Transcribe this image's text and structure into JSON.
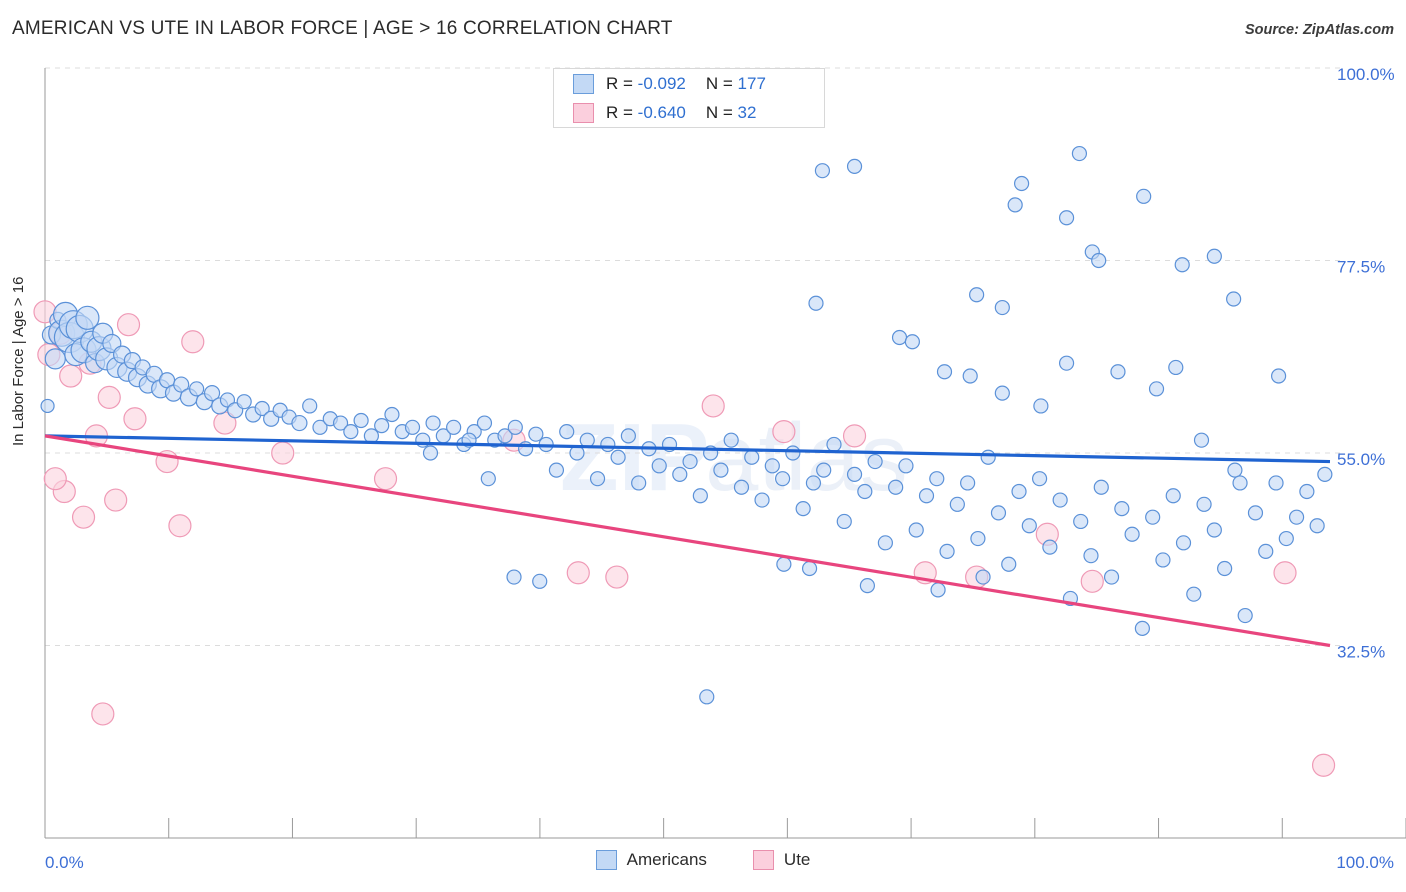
{
  "header": {
    "title": "AMERICAN VS UTE IN LABOR FORCE | AGE > 16 CORRELATION CHART",
    "source": "Source: ZipAtlas.com"
  },
  "watermark": {
    "part1": "ZIP",
    "part2": "atlas"
  },
  "axes": {
    "y_title": "In Labor Force | Age > 16",
    "y_ticks": [
      "100.0%",
      "77.5%",
      "55.0%",
      "32.5%"
    ],
    "x_left_label": "0.0%",
    "x_right_label": "100.0%"
  },
  "stats_legend": {
    "rows": [
      {
        "color": "#c3d9f5",
        "r_label": "R =",
        "r_value": "-0.092",
        "n_label": "N =",
        "n_value": "177"
      },
      {
        "color": "#fbcfdd",
        "r_label": "R =",
        "r_value": "-0.640",
        "n_label": "N =",
        "n_value": " 32"
      }
    ]
  },
  "series_legend": [
    {
      "label": "Americans",
      "color": "#c3d9f5"
    },
    {
      "label": "Ute",
      "color": "#fbcfdd"
    }
  ],
  "colors": {
    "blue_fill": "#c3d9f5",
    "blue_stroke": "#5b91d8",
    "pink_fill": "#fbd3df",
    "pink_stroke": "#ef9ab6",
    "blue_line": "#1f63d0",
    "pink_line": "#e8457e",
    "axis": "#9a9a9a",
    "grid": "#dcdcdc",
    "label_blue": "#3d6fd6"
  },
  "chart_data": {
    "type": "scatter",
    "title": "AMERICAN VS UTE IN LABOR FORCE | AGE > 16 CORRELATION CHART",
    "xlabel": "",
    "ylabel": "In Labor Force | Age > 16",
    "xlim": [
      0,
      100
    ],
    "ylim": [
      10.0,
      100.0
    ],
    "x_tick_values": [
      0,
      100
    ],
    "y_tick_values": [
      100.0,
      77.5,
      55.0,
      32.5
    ],
    "grid": "horizontal-dashed",
    "legend_position": "bottom-center",
    "series": [
      {
        "name": "Americans",
        "color": "#c3d9f5",
        "r": -0.092,
        "n": 177,
        "trendline": {
          "x0": 0,
          "y0": 57.0,
          "x1": 100,
          "y1": 54.0,
          "color": "#1f63d0"
        },
        "points": [
          [
            0.2,
            60.5,
            13
          ],
          [
            0.5,
            68.8,
            18
          ],
          [
            0.8,
            66.0,
            20
          ],
          [
            1.0,
            70.5,
            16
          ],
          [
            1.3,
            69.0,
            26
          ],
          [
            1.6,
            71.2,
            24
          ],
          [
            1.9,
            68.5,
            30
          ],
          [
            2.2,
            70.0,
            28
          ],
          [
            2.4,
            66.5,
            22
          ],
          [
            2.7,
            69.5,
            27
          ],
          [
            3.0,
            67.0,
            25
          ],
          [
            3.3,
            70.8,
            23
          ],
          [
            3.6,
            68.0,
            21
          ],
          [
            3.9,
            65.5,
            19
          ],
          [
            4.2,
            67.2,
            24
          ],
          [
            4.5,
            69.0,
            20
          ],
          [
            4.8,
            66.0,
            22
          ],
          [
            5.2,
            67.8,
            18
          ],
          [
            5.6,
            65.0,
            20
          ],
          [
            6.0,
            66.5,
            17
          ],
          [
            6.4,
            64.5,
            19
          ],
          [
            6.8,
            65.8,
            16
          ],
          [
            7.2,
            63.8,
            18
          ],
          [
            7.6,
            65.0,
            15
          ],
          [
            8.0,
            63.0,
            17
          ],
          [
            8.5,
            64.2,
            16
          ],
          [
            9.0,
            62.5,
            18
          ],
          [
            9.5,
            63.5,
            15
          ],
          [
            10.0,
            62.0,
            16
          ],
          [
            10.6,
            63.0,
            15
          ],
          [
            11.2,
            61.5,
            17
          ],
          [
            11.8,
            62.5,
            14
          ],
          [
            12.4,
            61.0,
            16
          ],
          [
            13.0,
            62.0,
            15
          ],
          [
            13.6,
            60.5,
            16
          ],
          [
            14.2,
            61.2,
            14
          ],
          [
            14.8,
            60.0,
            15
          ],
          [
            15.5,
            61.0,
            14
          ],
          [
            16.2,
            59.5,
            15
          ],
          [
            16.9,
            60.2,
            14
          ],
          [
            17.6,
            59.0,
            15
          ],
          [
            18.3,
            60.0,
            14
          ],
          [
            19.0,
            59.2,
            14
          ],
          [
            19.8,
            58.5,
            15
          ],
          [
            20.6,
            60.5,
            14
          ],
          [
            21.4,
            58.0,
            14
          ],
          [
            22.2,
            59.0,
            14
          ],
          [
            23.0,
            58.5,
            14
          ],
          [
            23.8,
            57.5,
            14
          ],
          [
            24.6,
            58.8,
            14
          ],
          [
            25.4,
            57.0,
            14
          ],
          [
            26.2,
            58.2,
            14
          ],
          [
            27.0,
            59.5,
            14
          ],
          [
            27.8,
            57.5,
            14
          ],
          [
            28.6,
            58.0,
            14
          ],
          [
            29.4,
            56.5,
            14
          ],
          [
            30.2,
            58.5,
            14
          ],
          [
            31.0,
            57.0,
            14
          ],
          [
            31.8,
            58.0,
            14
          ],
          [
            32.6,
            56.0,
            14
          ],
          [
            33.4,
            57.5,
            14
          ],
          [
            34.2,
            58.5,
            14
          ],
          [
            35.0,
            56.5,
            14
          ],
          [
            35.8,
            57.0,
            14
          ],
          [
            36.6,
            58.0,
            14
          ],
          [
            37.4,
            55.5,
            14
          ],
          [
            38.2,
            57.2,
            14
          ],
          [
            39.0,
            56.0,
            14
          ],
          [
            39.8,
            53.0,
            14
          ],
          [
            40.6,
            57.5,
            14
          ],
          [
            41.4,
            55.0,
            14
          ],
          [
            42.2,
            56.5,
            14
          ],
          [
            43.0,
            52.0,
            14
          ],
          [
            43.8,
            56.0,
            14
          ],
          [
            44.6,
            54.5,
            14
          ],
          [
            45.4,
            57.0,
            14
          ],
          [
            46.2,
            51.5,
            14
          ],
          [
            47.0,
            55.5,
            14
          ],
          [
            47.8,
            53.5,
            14
          ],
          [
            48.6,
            56.0,
            14
          ],
          [
            49.4,
            52.5,
            14
          ],
          [
            50.2,
            54.0,
            14
          ],
          [
            51.0,
            50.0,
            14
          ],
          [
            51.8,
            55.0,
            14
          ],
          [
            52.6,
            53.0,
            14
          ],
          [
            53.4,
            56.5,
            14
          ],
          [
            54.2,
            51.0,
            14
          ],
          [
            55.0,
            54.5,
            14
          ],
          [
            55.8,
            49.5,
            14
          ],
          [
            56.6,
            53.5,
            14
          ],
          [
            57.4,
            52.0,
            14
          ],
          [
            58.2,
            55.0,
            14
          ],
          [
            59.0,
            48.5,
            14
          ],
          [
            59.8,
            51.5,
            14
          ],
          [
            60.6,
            53.0,
            14
          ],
          [
            61.4,
            56.0,
            14
          ],
          [
            62.2,
            47.0,
            14
          ],
          [
            63.0,
            52.5,
            14
          ],
          [
            63.8,
            50.5,
            14
          ],
          [
            64.6,
            54.0,
            14
          ],
          [
            65.4,
            44.5,
            14
          ],
          [
            66.2,
            51.0,
            14
          ],
          [
            67.0,
            53.5,
            14
          ],
          [
            67.8,
            46.0,
            14
          ],
          [
            68.6,
            50.0,
            14
          ],
          [
            69.4,
            52.0,
            14
          ],
          [
            70.2,
            43.5,
            14
          ],
          [
            71.0,
            49.0,
            14
          ],
          [
            71.8,
            51.5,
            14
          ],
          [
            72.6,
            45.0,
            14
          ],
          [
            73.4,
            54.5,
            14
          ],
          [
            74.2,
            48.0,
            14
          ],
          [
            75.0,
            42.0,
            14
          ],
          [
            75.8,
            50.5,
            14
          ],
          [
            76.6,
            46.5,
            14
          ],
          [
            77.4,
            52.0,
            14
          ],
          [
            78.2,
            44.0,
            14
          ],
          [
            79.0,
            49.5,
            14
          ],
          [
            79.8,
            38.0,
            14
          ],
          [
            80.6,
            47.0,
            14
          ],
          [
            81.4,
            43.0,
            14
          ],
          [
            82.2,
            51.0,
            14
          ],
          [
            83.0,
            40.5,
            14
          ],
          [
            83.8,
            48.5,
            14
          ],
          [
            84.6,
            45.5,
            14
          ],
          [
            85.4,
            34.5,
            14
          ],
          [
            86.2,
            47.5,
            14
          ],
          [
            87.0,
            42.5,
            14
          ],
          [
            87.8,
            50.0,
            14
          ],
          [
            88.6,
            44.5,
            14
          ],
          [
            89.4,
            38.5,
            14
          ],
          [
            90.2,
            49.0,
            14
          ],
          [
            91.0,
            46.0,
            14
          ],
          [
            91.8,
            41.5,
            14
          ],
          [
            92.6,
            53.0,
            14
          ],
          [
            93.4,
            36.0,
            14
          ],
          [
            94.2,
            48.0,
            14
          ],
          [
            95.0,
            43.5,
            14
          ],
          [
            95.8,
            51.5,
            14
          ],
          [
            96.6,
            45.0,
            14
          ],
          [
            97.4,
            47.5,
            14
          ],
          [
            98.2,
            50.5,
            14
          ],
          [
            99.0,
            46.5,
            14
          ],
          [
            99.6,
            52.5,
            14
          ],
          [
            60.5,
            88.0,
            14
          ],
          [
            63.0,
            88.5,
            14
          ],
          [
            60.0,
            72.5,
            14
          ],
          [
            66.5,
            68.5,
            14
          ],
          [
            67.5,
            68.0,
            14
          ],
          [
            72.5,
            73.5,
            14
          ],
          [
            74.5,
            72.0,
            14
          ],
          [
            76.0,
            86.5,
            14
          ],
          [
            75.5,
            84.0,
            14
          ],
          [
            80.5,
            90.0,
            14
          ],
          [
            79.5,
            82.5,
            14
          ],
          [
            81.5,
            78.5,
            14
          ],
          [
            82.0,
            77.5,
            14
          ],
          [
            85.5,
            85.0,
            14
          ],
          [
            88.5,
            77.0,
            14
          ],
          [
            91.0,
            78.0,
            14
          ],
          [
            79.5,
            65.5,
            14
          ],
          [
            83.5,
            64.5,
            14
          ],
          [
            70.0,
            64.5,
            14
          ],
          [
            72.0,
            64.0,
            14
          ],
          [
            74.5,
            62.0,
            14
          ],
          [
            77.5,
            60.5,
            14
          ],
          [
            86.5,
            62.5,
            14
          ],
          [
            88.0,
            65.0,
            14
          ],
          [
            92.5,
            73.0,
            14
          ],
          [
            96.0,
            64.0,
            14
          ],
          [
            90.0,
            56.5,
            14
          ],
          [
            93.0,
            51.5,
            14
          ],
          [
            51.5,
            26.5,
            14
          ],
          [
            36.5,
            40.5,
            14
          ],
          [
            38.5,
            40.0,
            14
          ],
          [
            64.0,
            39.5,
            14
          ],
          [
            69.5,
            39.0,
            14
          ],
          [
            73.0,
            40.5,
            14
          ],
          [
            59.5,
            41.5,
            14
          ],
          [
            57.5,
            42.0,
            14
          ],
          [
            34.5,
            52.0,
            14
          ],
          [
            33.0,
            56.5,
            14
          ],
          [
            30.0,
            55.0,
            14
          ]
        ]
      },
      {
        "name": "Ute",
        "color": "#fbd3df",
        "r": -0.64,
        "n": 32,
        "trendline": {
          "x0": 0,
          "y0": 57.0,
          "x1": 100,
          "y1": 32.5,
          "color": "#e8457e"
        },
        "points": [
          [
            0.0,
            71.5,
            22
          ],
          [
            0.3,
            66.5,
            22
          ],
          [
            1.2,
            69.0,
            22
          ],
          [
            2.0,
            64.0,
            22
          ],
          [
            3.5,
            65.5,
            22
          ],
          [
            4.0,
            57.0,
            22
          ],
          [
            5.0,
            61.5,
            22
          ],
          [
            6.5,
            70.0,
            22
          ],
          [
            1.5,
            50.5,
            22
          ],
          [
            0.8,
            52.0,
            22
          ],
          [
            5.5,
            49.5,
            22
          ],
          [
            7.0,
            59.0,
            22
          ],
          [
            11.5,
            68.0,
            22
          ],
          [
            9.5,
            54.0,
            22
          ],
          [
            10.5,
            46.5,
            22
          ],
          [
            14.0,
            58.5,
            22
          ],
          [
            3.0,
            47.5,
            22
          ],
          [
            4.5,
            24.5,
            22
          ],
          [
            26.5,
            52.0,
            22
          ],
          [
            18.5,
            55.0,
            22
          ],
          [
            36.5,
            56.5,
            22
          ],
          [
            41.5,
            41.0,
            22
          ],
          [
            44.5,
            40.5,
            22
          ],
          [
            52.0,
            60.5,
            22
          ],
          [
            57.5,
            57.5,
            22
          ],
          [
            68.5,
            41.0,
            22
          ],
          [
            72.5,
            40.5,
            22
          ],
          [
            78.0,
            45.5,
            22
          ],
          [
            81.5,
            40.0,
            22
          ],
          [
            96.5,
            41.0,
            22
          ],
          [
            99.5,
            18.5,
            22
          ],
          [
            63.0,
            57.0,
            22
          ]
        ]
      }
    ]
  }
}
